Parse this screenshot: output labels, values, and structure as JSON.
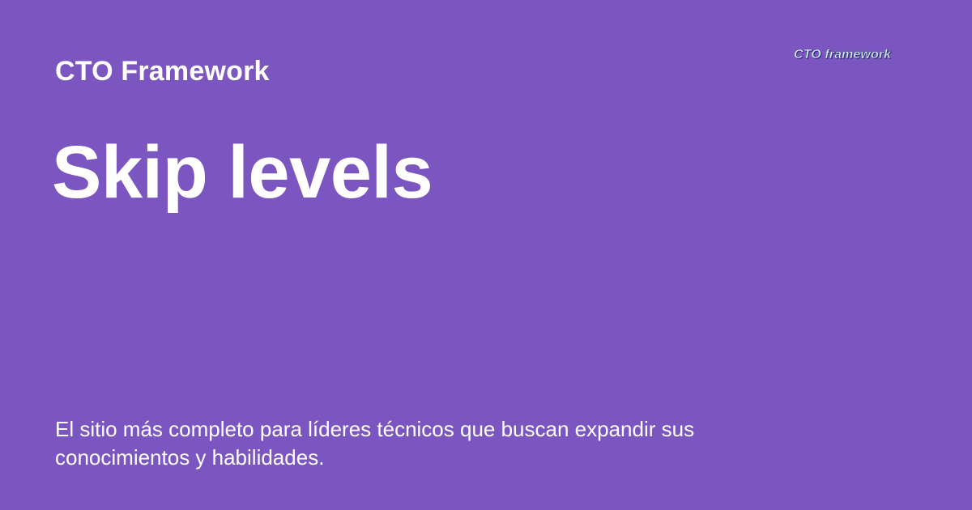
{
  "header": {
    "site_name": "CTO Framework"
  },
  "logo": {
    "text": "CTO framework"
  },
  "main": {
    "title": "Skip levels",
    "description": "El sitio más completo para líderes técnicos que buscan expandir sus conocimientos y habilidades."
  },
  "colors": {
    "background": "#7c56c0",
    "text": "#ffffff"
  }
}
